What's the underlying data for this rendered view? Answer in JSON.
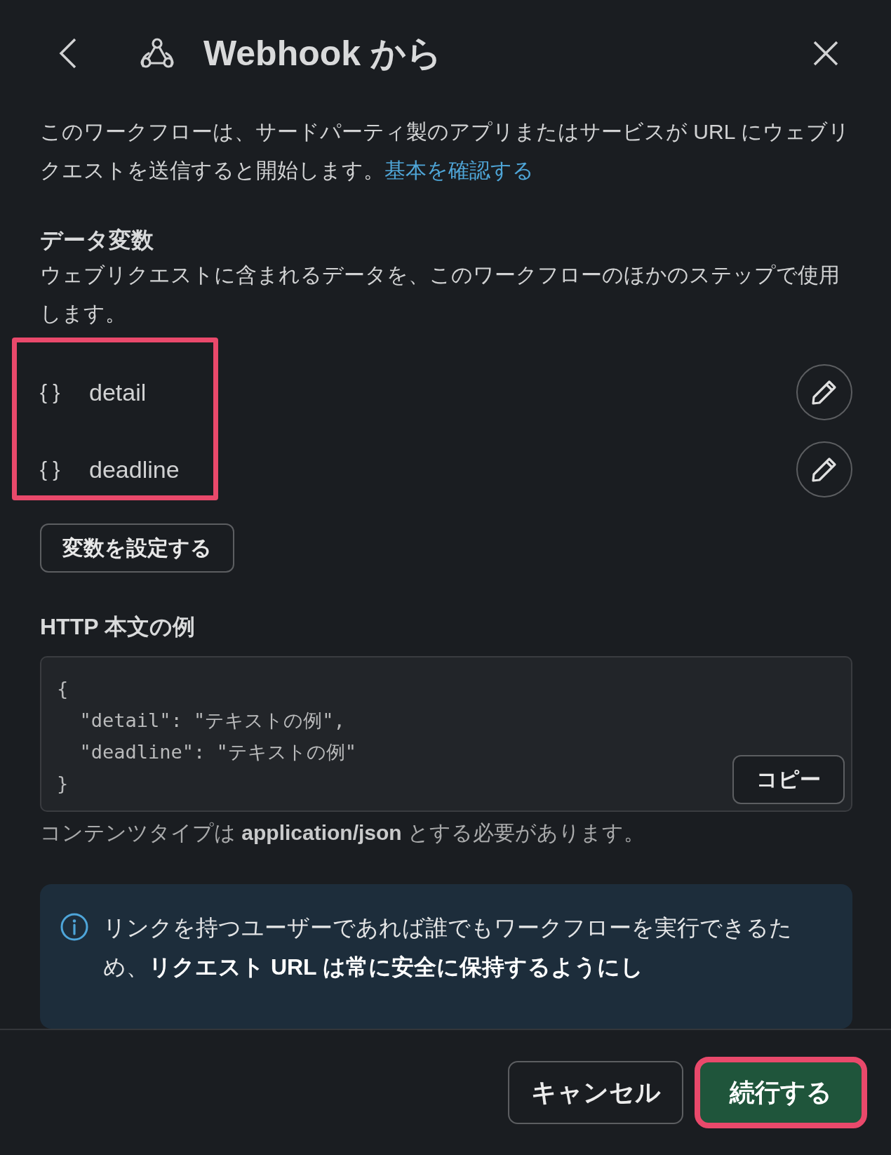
{
  "header": {
    "title": "Webhook から"
  },
  "description": {
    "text": "このワークフローは、サードパーティ製のアプリまたはサービスが URL にウェブリクエストを送信すると開始します。",
    "link": "基本を確認する"
  },
  "variables_section": {
    "title": "データ変数",
    "subtitle": "ウェブリクエストに含まれるデータを、このワークフローのほかのステップで使用します。",
    "highlighted": true,
    "variables": [
      {
        "icon": "{ }",
        "name": "detail"
      },
      {
        "icon": "{ }",
        "name": "deadline"
      }
    ],
    "set_button": "変数を設定する"
  },
  "example_section": {
    "title": "HTTP 本文の例",
    "code_lines": [
      "{",
      "  \"detail\": \"テキストの例\",",
      "  \"deadline\": \"テキストの例\"",
      "}"
    ],
    "copy_button": "コピー",
    "note": "コンテンツタイプは **application/json** とする必要があります。"
  },
  "info": {
    "text": "リンクを持つユーザーであれば誰でもワークフローを実行できるため、**リクエスト URL は常に安全に保持するようにし**"
  },
  "footer": {
    "buttons": [
      {
        "label": "キャンセル",
        "kind": "secondary",
        "highlighted": false
      },
      {
        "label": "続行する",
        "kind": "primary",
        "highlighted": true
      }
    ]
  }
}
